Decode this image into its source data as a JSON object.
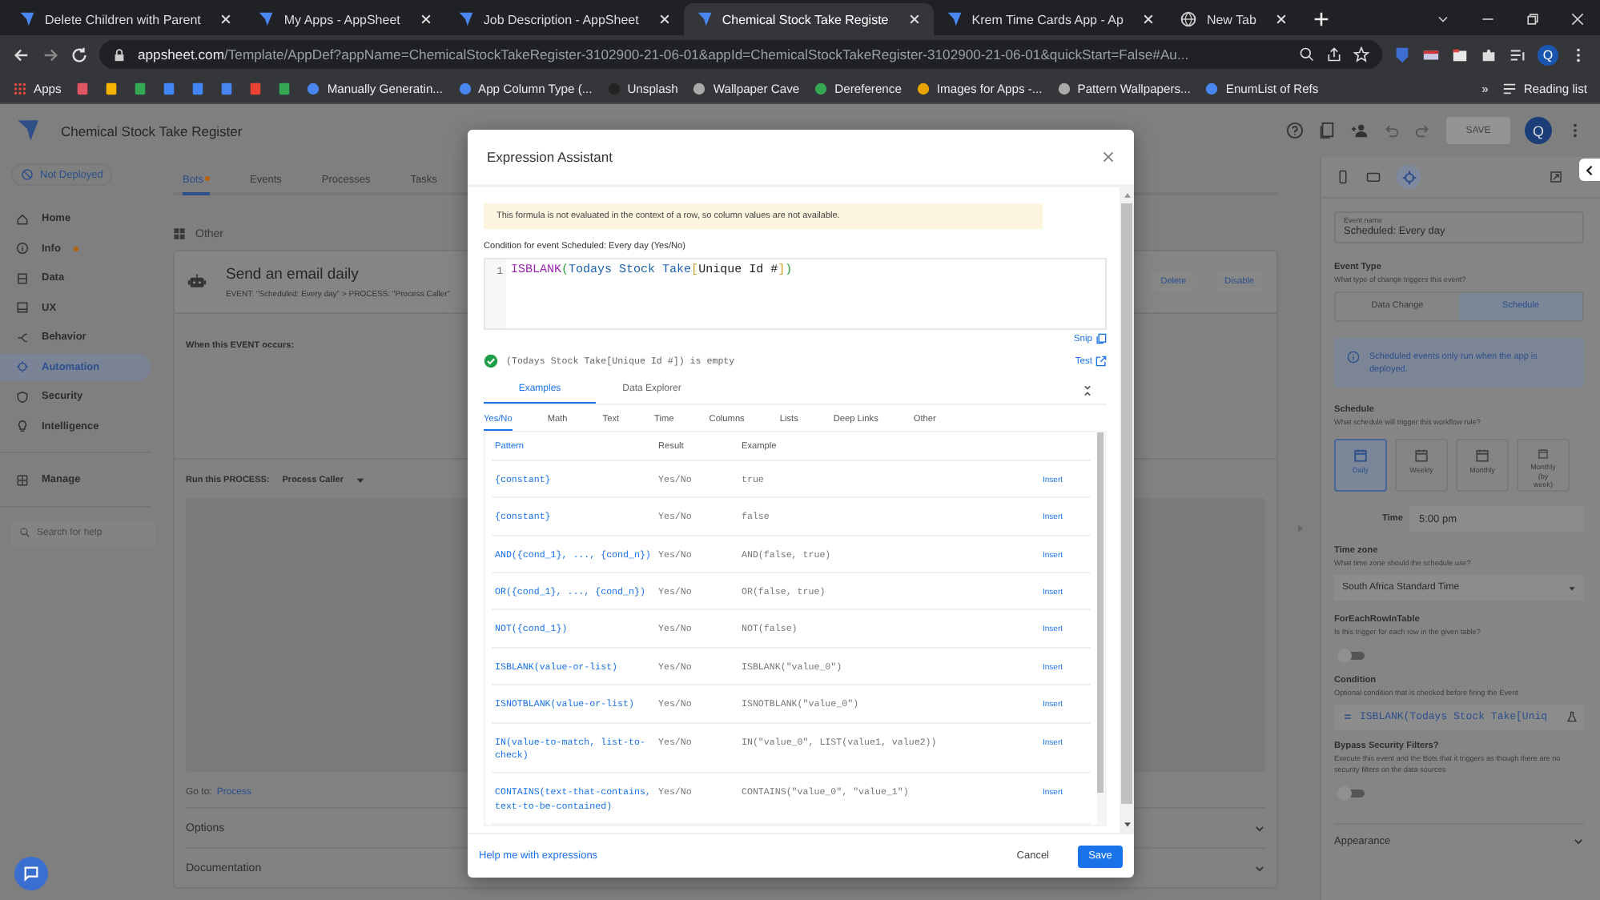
{
  "browser": {
    "tabs": [
      {
        "title": "Delete Children with Parent",
        "selected": false
      },
      {
        "title": "My Apps - AppSheet",
        "selected": false
      },
      {
        "title": "Job Description - AppSheet",
        "selected": false
      },
      {
        "title": "Chemical Stock Take Registe",
        "selected": true
      },
      {
        "title": "Krem Time Cards App - Ap",
        "selected": false
      },
      {
        "title": "New Tab",
        "selected": false
      }
    ],
    "url_domain": "appsheet.com",
    "url_path": "/Template/AppDef?appName=ChemicalStockTakeRegister-3102900-21-06-01&appId=ChemicalStockTakeRegister-3102900-21-06-01&quickStart=False#Au...",
    "profile": "Q",
    "bookmarks": [
      {
        "label": "Apps"
      },
      {
        "label": "Manually Generatin..."
      },
      {
        "label": "App Column Type (..."
      },
      {
        "label": "Unsplash"
      },
      {
        "label": "Wallpaper Cave"
      },
      {
        "label": "Dereference"
      },
      {
        "label": "Images for Apps -..."
      },
      {
        "label": "Pattern Wallpapers..."
      },
      {
        "label": "EnumList of Refs"
      }
    ],
    "more": "»",
    "reading_list": "Reading list"
  },
  "app": {
    "title": "Chemical Stock Take Register",
    "save": "SAVE",
    "avatar": "Q",
    "deploy_status": "Not Deployed",
    "nav": [
      {
        "label": "Home",
        "selected": false,
        "dot": false
      },
      {
        "label": "Info",
        "selected": false,
        "dot": true
      },
      {
        "label": "Data",
        "selected": false,
        "dot": false
      },
      {
        "label": "UX",
        "selected": false,
        "dot": false
      },
      {
        "label": "Behavior",
        "selected": false,
        "dot": false
      },
      {
        "label": "Automation",
        "selected": true,
        "dot": false
      },
      {
        "label": "Security",
        "selected": false,
        "dot": false
      },
      {
        "label": "Intelligence",
        "selected": false,
        "dot": false
      }
    ],
    "manage": "Manage",
    "search_placeholder": "Search for help",
    "tabs": [
      {
        "label": "Bots",
        "selected": true,
        "dot": true
      },
      {
        "label": "Events",
        "selected": false,
        "dot": false
      },
      {
        "label": "Processes",
        "selected": false,
        "dot": false
      },
      {
        "label": "Tasks",
        "selected": false,
        "dot": false
      }
    ],
    "group": "Other",
    "bot": {
      "name": "Send an email daily",
      "summary": "EVENT: \"Scheduled: Every day\" > PROCESS: \"Process Caller\"",
      "actions": [
        "Delete",
        "Disable"
      ],
      "event_heading": "When this EVENT occurs:",
      "process_heading": "Run this PROCESS:",
      "process": "Process Caller",
      "goto_label": "Go to:",
      "goto_link": "Process",
      "sections": [
        "Options",
        "Documentation"
      ]
    }
  },
  "panel": {
    "event_name": {
      "label": "Event name",
      "value": "Scheduled: Every day"
    },
    "event_type": {
      "label": "Event Type",
      "hint": "What type of change triggers this event?",
      "options": [
        {
          "label": "Data Change",
          "selected": false
        },
        {
          "label": "Schedule",
          "selected": true
        }
      ]
    },
    "info": "Scheduled events only run when the app is deployed.",
    "schedule": {
      "label": "Schedule",
      "hint": "What schedule will trigger this workflow rule?",
      "options": [
        {
          "label": "Daily",
          "selected": true
        },
        {
          "label": "Weekly",
          "selected": false
        },
        {
          "label": "Monthly",
          "selected": false
        },
        {
          "label": "Monthly (by week)",
          "selected": false
        }
      ]
    },
    "time": {
      "label": "Time",
      "value": "5:00 pm"
    },
    "time_zone": {
      "label": "Time zone",
      "hint": "What time zone should the schedule use?",
      "value": "South Africa Standard Time"
    },
    "for_each": {
      "label": "ForEachRowInTable",
      "hint": "Is this trigger for each row in the given table?",
      "on": false
    },
    "condition": {
      "label": "Condition",
      "hint": "Optional condition that is checked before firing the Event",
      "value": "ISBLANK(Todays Stock Take[Uniq"
    },
    "bypass": {
      "label": "Bypass Security Filters?",
      "hint": "Execute this event and the Bots that it triggers as though there are no security filters on the data sources",
      "on": false
    },
    "appearance": "Appearance"
  },
  "modal": {
    "title": "Expression Assistant",
    "notice": "This formula is not evaluated in the context of a row, so column values are not available.",
    "condition_label": "Condition for event Scheduled: Every day (Yes/No)",
    "line_number": "1",
    "code": [
      {
        "text": "ISBLANK",
        "kind": "function"
      },
      {
        "text": "(",
        "kind": "paren"
      },
      {
        "text": "Todays Stock Take",
        "kind": "table"
      },
      {
        "text": "[",
        "kind": "bracket"
      },
      {
        "text": "Unique Id #",
        "kind": "column"
      },
      {
        "text": "]",
        "kind": "bracket"
      },
      {
        "text": ")",
        "kind": "paren"
      }
    ],
    "snip": "Snip",
    "valid": true,
    "result": "(Todays Stock Take[Unique Id #]) is empty",
    "test": "Test",
    "tabs": [
      {
        "label": "Examples",
        "selected": true
      },
      {
        "label": "Data Explorer",
        "selected": false
      }
    ],
    "categories": [
      {
        "label": "Yes/No",
        "selected": true
      },
      {
        "label": "Math",
        "selected": false
      },
      {
        "label": "Text",
        "selected": false
      },
      {
        "label": "Time",
        "selected": false
      },
      {
        "label": "Columns",
        "selected": false
      },
      {
        "label": "Lists",
        "selected": false
      },
      {
        "label": "Deep Links",
        "selected": false
      },
      {
        "label": "Other",
        "selected": false
      }
    ],
    "columns": [
      "Pattern",
      "Result",
      "Example"
    ],
    "rows": [
      {
        "pattern": "{constant}",
        "result": "Yes/No",
        "example": "true",
        "action": "Insert"
      },
      {
        "pattern": "{constant}",
        "result": "Yes/No",
        "example": "false",
        "action": "Insert"
      },
      {
        "pattern": "AND({cond_1}, ..., {cond_n})",
        "result": "Yes/No",
        "example": "AND(false, true)",
        "action": "Insert"
      },
      {
        "pattern": "OR({cond_1}, ..., {cond_n})",
        "result": "Yes/No",
        "example": "OR(false, true)",
        "action": "Insert"
      },
      {
        "pattern": "NOT({cond_1})",
        "result": "Yes/No",
        "example": "NOT(false)",
        "action": "Insert"
      },
      {
        "pattern": "ISBLANK(value-or-list)",
        "result": "Yes/No",
        "example": "ISBLANK(\"value_0\")",
        "action": "Insert"
      },
      {
        "pattern": "ISNOTBLANK(value-or-list)",
        "result": "Yes/No",
        "example": "ISNOTBLANK(\"value_0\")",
        "action": "Insert"
      },
      {
        "pattern": "IN(value-to-match, list-to-check)",
        "result": "Yes/No",
        "example": "IN(\"value_0\", LIST(value1, value2))",
        "action": "Insert"
      },
      {
        "pattern": "CONTAINS(text-that-contains, text-to-be-contained)",
        "result": "Yes/No",
        "example": "CONTAINS(\"value_0\", \"value_1\")",
        "action": "Insert"
      }
    ],
    "help_link": "Help me with expressions",
    "cancel": "Cancel",
    "save": "Save"
  }
}
